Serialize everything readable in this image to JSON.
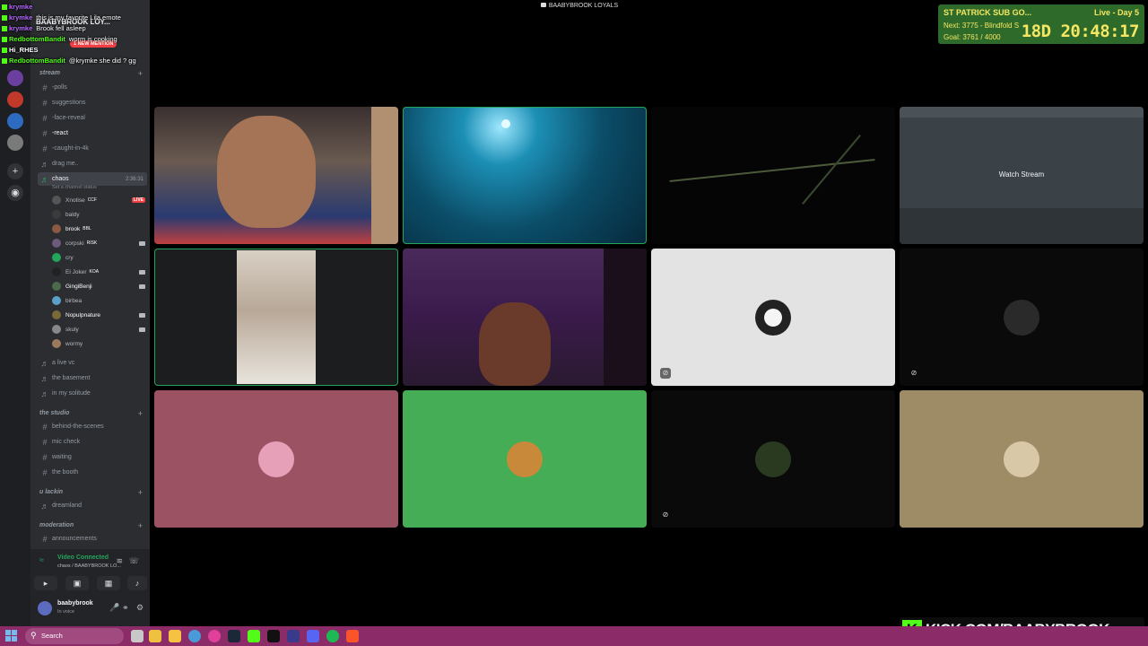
{
  "window_title": "BAABYBROOK LOYALS",
  "chat": [
    {
      "user": "krymke",
      "message": "",
      "user_color": "#b36bff"
    },
    {
      "user": "krymke",
      "message": "this is my favorite Lila emote",
      "user_color": "#b36bff"
    },
    {
      "user": "krymke",
      "message": "Brook fell asleep",
      "user_color": "#b36bff"
    },
    {
      "user": "RedbottomBandit",
      "message": "worm is cooking",
      "user_color": "#53fc18"
    },
    {
      "user": "Hi_RHES",
      "message": "",
      "user_color": "#ffffff"
    },
    {
      "user": "RedbottomBandit",
      "message": "@krymke she did ? gg",
      "user_color": "#53fc18"
    }
  ],
  "sidebar": {
    "server_name": "BAABYBROOK LOY...",
    "mention_badge": "1 NEW MENTION",
    "category_stream": "stream",
    "channels_top": [
      {
        "label": "-polls",
        "type": "text"
      },
      {
        "label": "suggestions",
        "type": "text"
      },
      {
        "label": "-face-reveal",
        "type": "text"
      },
      {
        "label": "-react",
        "type": "text"
      },
      {
        "label": "-caught-in-4k",
        "type": "text"
      },
      {
        "label": "drag me..",
        "type": "voice"
      }
    ],
    "active_voice": {
      "label": "chaos",
      "time": "2:36:31",
      "status": "Set a channel status"
    },
    "vc_users": [
      {
        "name": "Xnotise",
        "tag": "CCF",
        "live": "LIVE"
      },
      {
        "name": "baldy"
      },
      {
        "name": "brook",
        "tag": "BBL"
      },
      {
        "name": "corpski",
        "tag": "RISK"
      },
      {
        "name": "cry"
      },
      {
        "name": "El Joker",
        "tag": "KOA"
      },
      {
        "name": "GingiBenji"
      },
      {
        "name": "birbea"
      },
      {
        "name": "Nopulpnature"
      },
      {
        "name": "skuly"
      },
      {
        "name": "wormy"
      }
    ],
    "channels_mid": [
      {
        "label": "a live vc"
      },
      {
        "label": "the basement"
      },
      {
        "label": "in my solitude"
      }
    ],
    "category_studio": "the studio",
    "channels_studio": [
      {
        "label": "behind-the-scenes"
      },
      {
        "label": "mic check"
      },
      {
        "label": "waiting"
      },
      {
        "label": "the booth"
      }
    ],
    "category_lackin": "u lackin",
    "channels_lackin": [
      {
        "label": "dreamland"
      }
    ],
    "category_mod": "moderation",
    "channels_mod": [
      {
        "label": "announcements"
      }
    ]
  },
  "voice_panel": {
    "title": "Video Connected",
    "subtitle": "chaos / BAABYBROOK LO..."
  },
  "user_panel": {
    "name": "baabybrook",
    "status": "In voice"
  },
  "tiles": {
    "watch_stream_label": "Watch Stream"
  },
  "sub_goal": {
    "title": "ST PATRICK SUB GO...",
    "next": "Next: 3775 - Blindfold S",
    "goal": "Goal: 3761 / 4000",
    "live_day": "Live - Day 5",
    "timer": "18D 20:48:17"
  },
  "kick_banner": {
    "logo": "K",
    "text": "KICK.COM/BAABYBROOK"
  },
  "taskbar": {
    "search_placeholder": "Search"
  },
  "colors": {
    "speaking_outline": "#23a55a",
    "goal_bg": "#2e6b2a",
    "goal_text": "#f5e663",
    "taskbar": "#8b2c68",
    "kick_green": "#53fc18"
  }
}
